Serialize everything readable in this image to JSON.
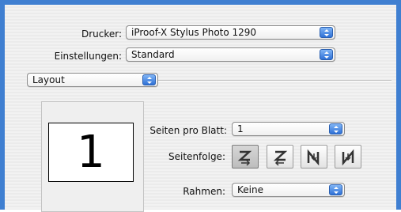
{
  "printer": {
    "label": "Drucker:",
    "value": "iProof-X Stylus Photo 1290"
  },
  "settings": {
    "label": "Einstellungen:",
    "value": "Standard"
  },
  "panel_select": {
    "value": "Layout"
  },
  "preview": {
    "page_number": "1"
  },
  "pages_per_sheet": {
    "label": "Seiten pro Blatt:",
    "value": "1"
  },
  "page_order": {
    "label": "Seitenfolge:",
    "options": [
      "z-order-icon",
      "reverse-z-order-icon",
      "n-order-icon",
      "reverse-n-order-icon"
    ],
    "selected_index": 0
  },
  "border": {
    "label": "Rahmen:",
    "value": "Keine"
  },
  "colors": {
    "accent": "#3f7fd1",
    "button_blue": "#2f71d6"
  }
}
